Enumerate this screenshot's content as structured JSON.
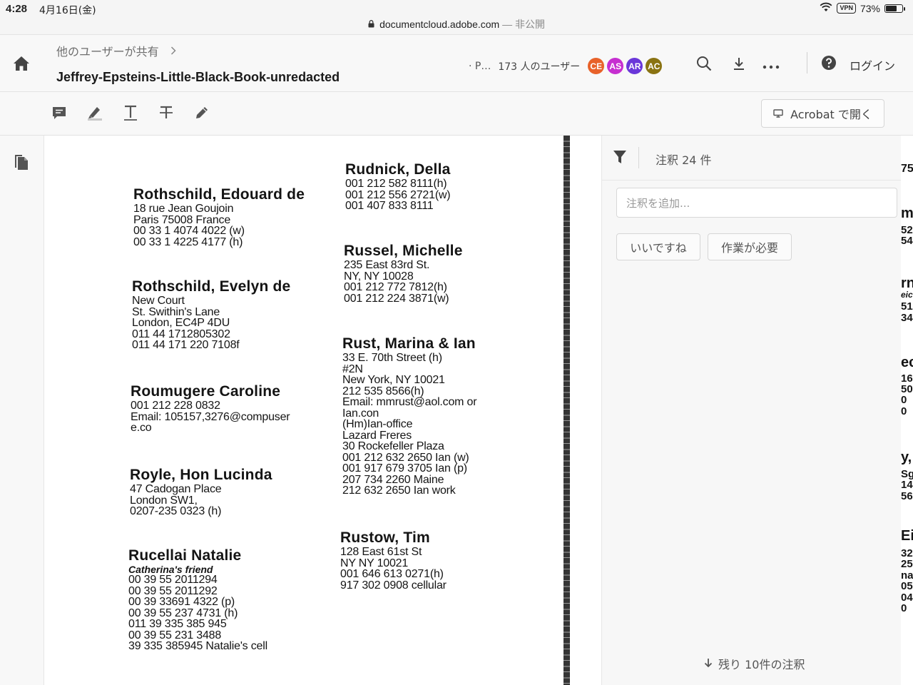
{
  "status_bar": {
    "time": "4:28",
    "date": "4月16日(金)",
    "vpn": "VPN",
    "battery": "73%",
    "battery_level": 0.73,
    "url": "documentcloud.adobe.com",
    "url_suffix": " — 非公開"
  },
  "header": {
    "breadcrumb": "他のユーザーが共有",
    "title": "Jeffrey-Epsteins-Little-Black-Book-unredacted",
    "shared_truncated": "· P…",
    "users_label": "173 人のユーザー",
    "avatars": [
      {
        "initials": "CE",
        "color": "#e8622a"
      },
      {
        "initials": "AS",
        "color": "#c62fd0"
      },
      {
        "initials": "AR",
        "color": "#6a37d9"
      },
      {
        "initials": "AC",
        "color": "#8a7312"
      }
    ],
    "login": "ログイン"
  },
  "toolbar": {
    "open_in_acrobat": "Acrobat で開く"
  },
  "document": {
    "left_column": [
      {
        "name": "Rothschild, Edouard de",
        "lines": [
          "18 rue Jean Goujoin",
          "Paris 75008 France",
          "00 33 1 4074 4022 (w)",
          "00 33 1 4225 4177 (h)"
        ]
      },
      {
        "name": "Rothschild, Evelyn de",
        "lines": [
          "New Court",
          "St. Swithin's Lane",
          "London,  EC4P 4DU",
          "011 44 1712805302",
          "011 44 171 220 7108f"
        ]
      },
      {
        "name": "Roumugere Caroline",
        "lines": [
          "001 212 228 0832",
          "Email: 105157,3276@compuser",
          "e.co"
        ]
      },
      {
        "name": "Royle, Hon Lucinda",
        "lines": [
          "47 Cadogan Place",
          "London  SW1,",
          "0207-235 0323 (h)"
        ]
      },
      {
        "name": "Rucellai Natalie",
        "note": "Catherina's friend",
        "lines": [
          "00 39 55 2011294",
          "00 39 55 2011292",
          "00 39 33691 4322 (p)",
          "00 39 55 237 4731 (h)",
          "011 39 335 385 945",
          "00 39 55 231 3488",
          "39 335 385945 Natalie's cell"
        ]
      }
    ],
    "right_column": [
      {
        "name": "Rudnick, Della",
        "lines": [
          "001 212 582 8111(h)",
          "001 212 556 2721(w)",
          "001 407 833 8111"
        ]
      },
      {
        "name": "Russel, Michelle",
        "lines": [
          "235 East 83rd St.",
          "NY, NY 10028",
          " 001 212 772 7812(h)",
          " 001 212 224 3871(w)"
        ]
      },
      {
        "name": "Rust, Marina & Ian",
        "lines": [
          "33 E. 70th Street (h)",
          "#2N",
          "New York, NY 10021",
          "212 535 8566(h)",
          "Email: mmrust@aol.com or",
          "Ian.con",
          "(Hm)Ian-office",
          "Lazard Freres",
          "30 Rockefeller Plaza",
          "001 212 632 2650 Ian (w)",
          "001 917 679 3705 Ian (p)",
          "207 734 2260 Maine",
          "212 632 2650 Ian work"
        ]
      },
      {
        "name": "Rustow, Tim",
        "lines": [
          "128 East 61st St",
          "NY NY 10021",
          "001 646 613 0271(h)",
          "917 302 0908 cellular"
        ]
      }
    ]
  },
  "comments_panel": {
    "count_label": "注釈 24 件",
    "add_placeholder": "注釈を追加...",
    "filter_like": "いいですね",
    "filter_action": "作業が必要",
    "remaining": "残り 10件の注釈"
  },
  "peek_page": {
    "fragments": [
      "75",
      "m",
      "52",
      "54",
      "rn",
      "eic",
      "51",
      "34",
      "ec",
      "16",
      "50",
      "0",
      "0",
      "y,",
      "Sg",
      "14",
      "56",
      "Ei",
      "32",
      "25",
      "na",
      "05",
      "04",
      "0"
    ]
  }
}
